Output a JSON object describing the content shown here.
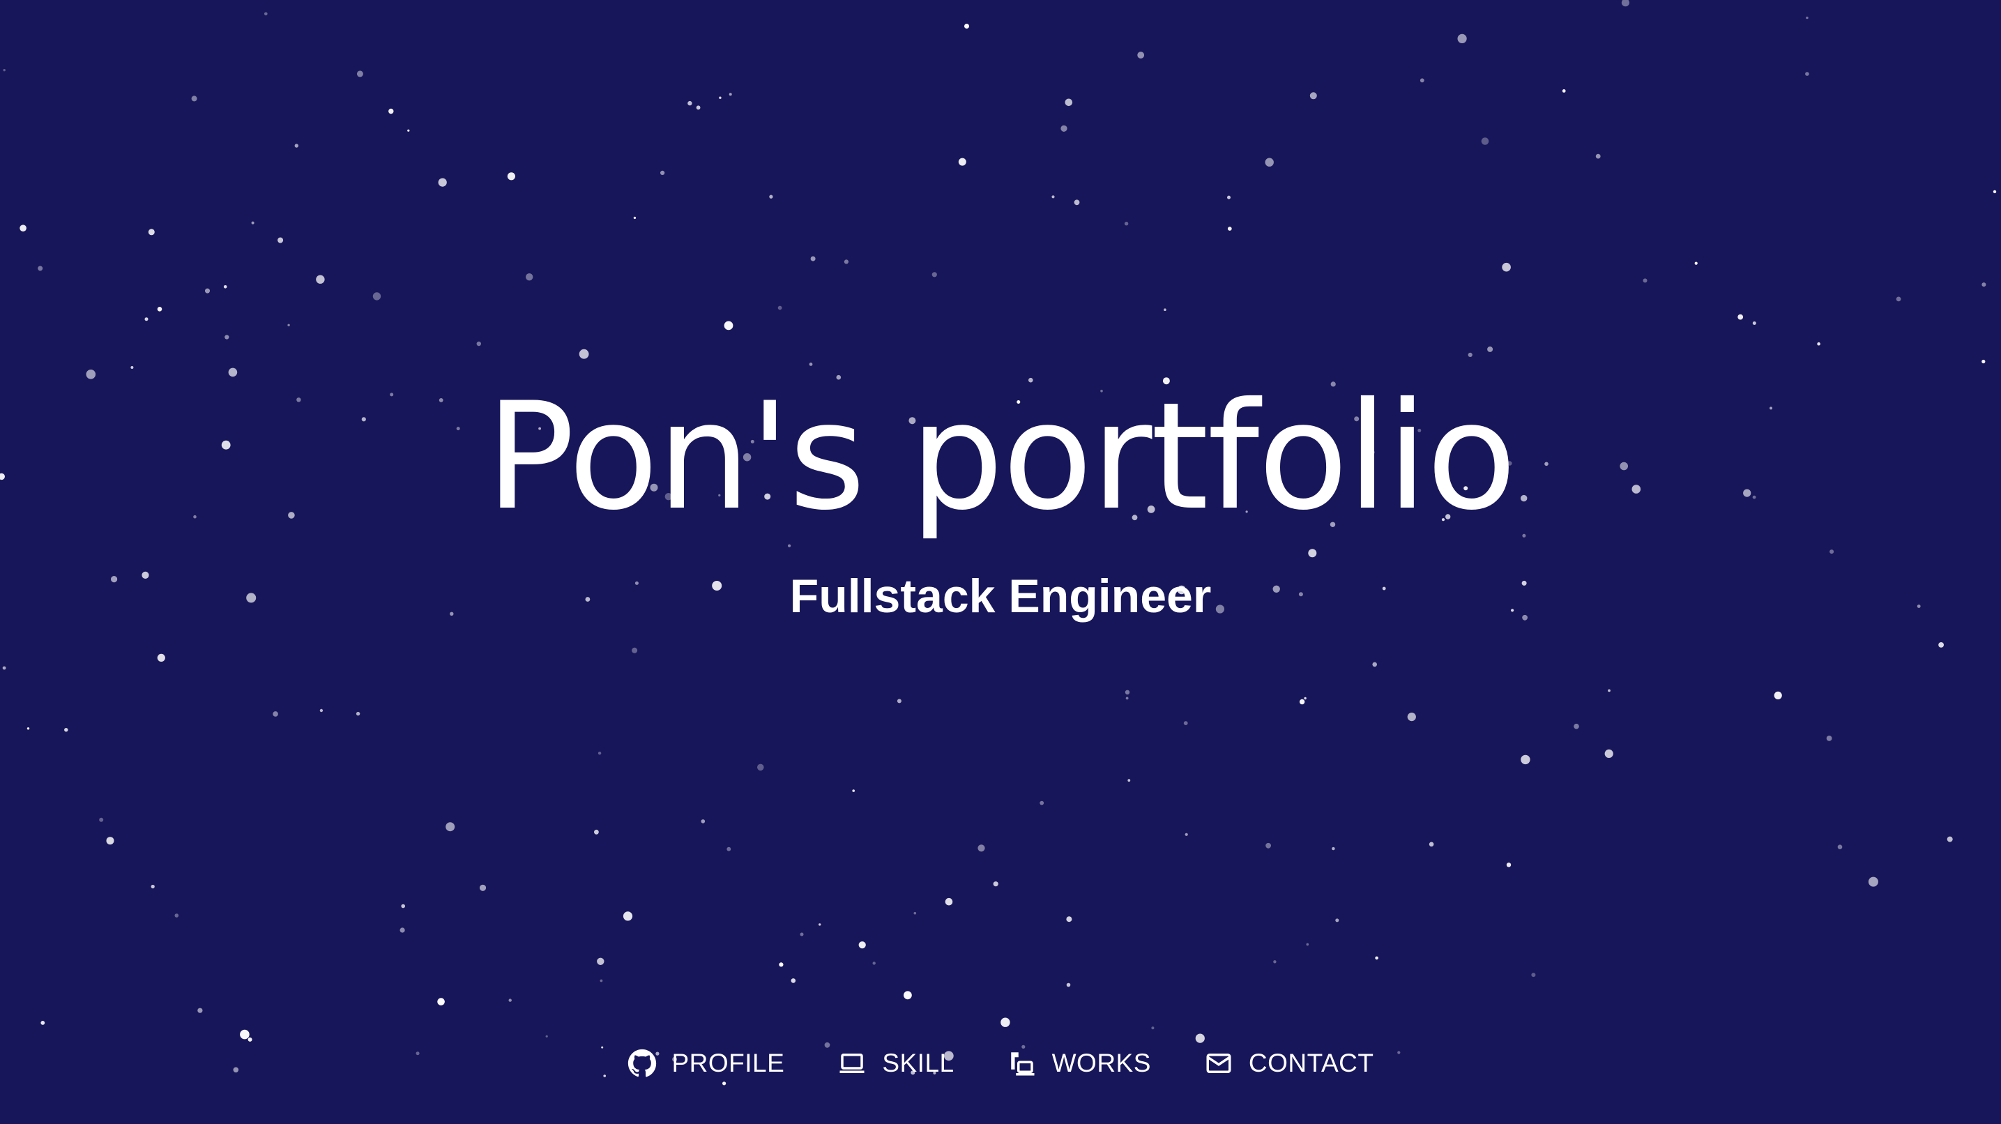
{
  "hero": {
    "title": "Pon's portfolio",
    "subtitle": "Fullstack Engineer"
  },
  "nav": [
    {
      "label": "PROFILE",
      "icon": "github-icon"
    },
    {
      "label": "SKILL",
      "icon": "laptop-icon"
    },
    {
      "label": "WORKS",
      "icon": "devices-icon"
    },
    {
      "label": "CONTACT",
      "icon": "mail-icon"
    }
  ],
  "colors": {
    "background": "#18165a",
    "text": "#ffffff",
    "star": "#ffffff"
  }
}
